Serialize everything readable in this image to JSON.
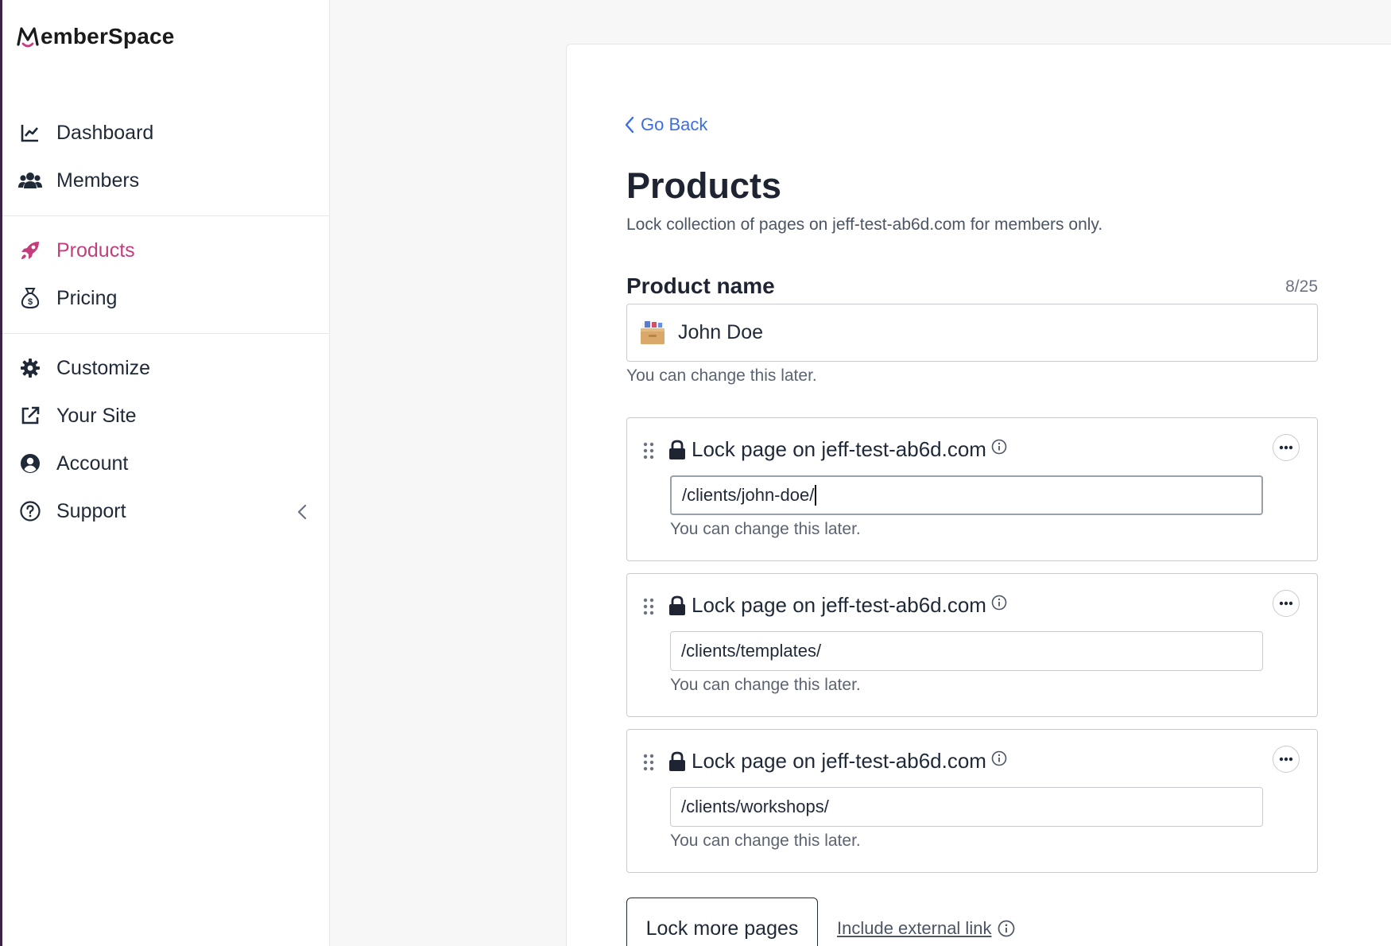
{
  "app": {
    "name": "MemberSpace",
    "accent": "#c53d7d",
    "link_color": "#3b6fe0"
  },
  "sidebar": {
    "groups": [
      [
        {
          "label": "Dashboard",
          "icon": "chart-line-icon",
          "active": false
        },
        {
          "label": "Members",
          "icon": "users-icon",
          "active": false
        }
      ],
      [
        {
          "label": "Products",
          "icon": "rocket-icon",
          "active": true
        },
        {
          "label": "Pricing",
          "icon": "money-bag-icon",
          "active": false
        }
      ],
      [
        {
          "label": "Customize",
          "icon": "gear-icon",
          "active": false
        },
        {
          "label": "Your Site",
          "icon": "external-link-icon",
          "active": false
        },
        {
          "label": "Account",
          "icon": "user-circle-icon",
          "active": false
        },
        {
          "label": "Support",
          "icon": "question-circle-icon",
          "active": false
        }
      ]
    ],
    "collapse_icon": "chevron-left-icon"
  },
  "main": {
    "back_label": "Go Back",
    "title": "Products",
    "subtitle": "Lock collection of pages on jeff-test-ab6d.com for members only.",
    "product_name": {
      "label": "Product name",
      "counter": "8/25",
      "value": "John Doe",
      "icon": "card-file-box-emoji",
      "hint": "You can change this later."
    },
    "lock_cards": [
      {
        "title": "Lock page on jeff-test-ab6d.com",
        "path": "/clients/john-doe/",
        "focused": true,
        "hint": "You can change this later."
      },
      {
        "title": "Lock page on jeff-test-ab6d.com",
        "path": "/clients/templates/",
        "focused": false,
        "hint": "You can change this later."
      },
      {
        "title": "Lock page on jeff-test-ab6d.com",
        "path": "/clients/workshops/",
        "focused": false,
        "hint": "You can change this later."
      }
    ],
    "lock_more_label": "Lock more pages",
    "external_link_label": "Include external link"
  }
}
